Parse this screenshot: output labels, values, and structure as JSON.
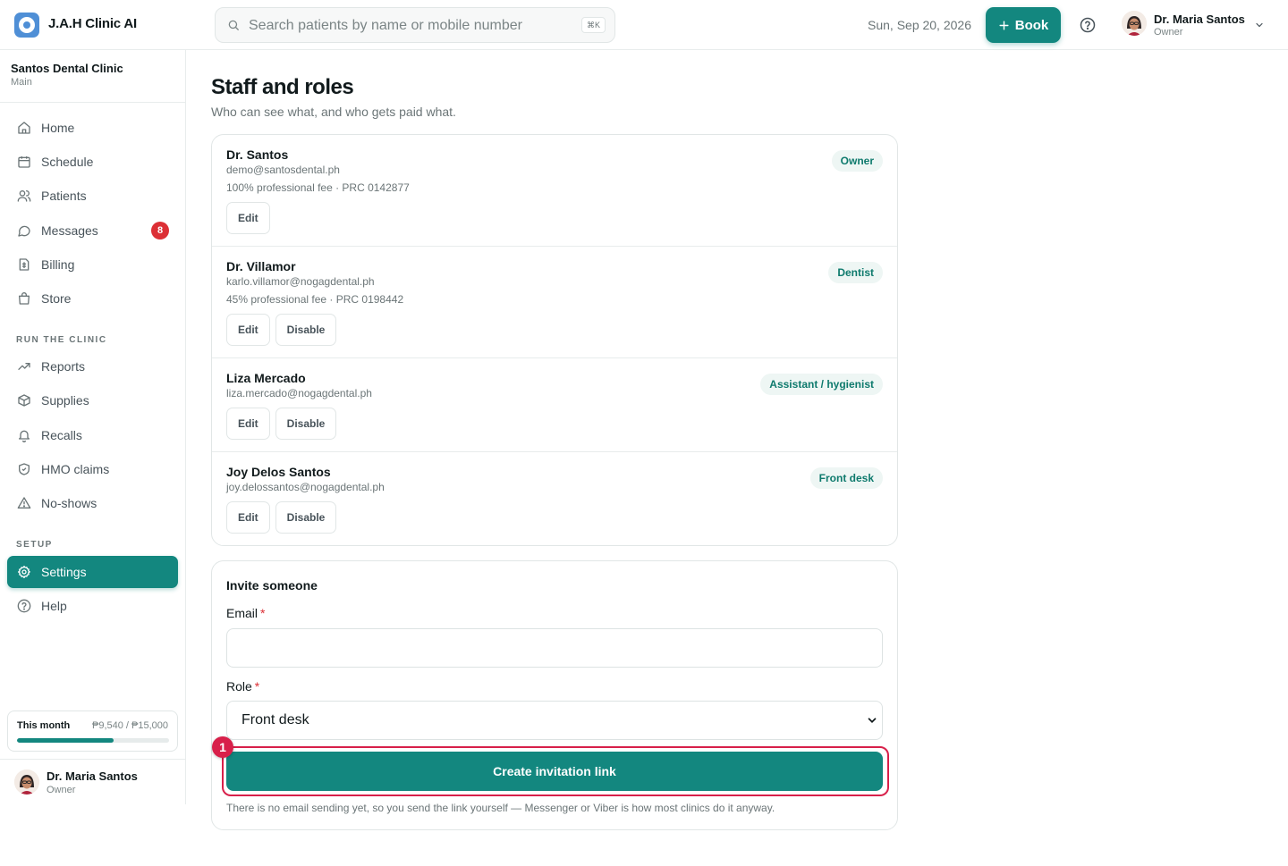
{
  "app": {
    "brand": "J.A.H Clinic AI",
    "search_placeholder": "Search patients by name or mobile number",
    "search_shortcut": "⌘K",
    "date": "Sun, Sep 20, 2026",
    "book_label": "Book",
    "user": {
      "name": "Dr. Maria Santos",
      "role": "Owner"
    },
    "accent_color": "#13877f"
  },
  "sidebar": {
    "clinic_name": "Santos Dental Clinic",
    "clinic_sub": "Main",
    "main_items": [
      {
        "label": "Home",
        "icon": "home-icon"
      },
      {
        "label": "Schedule",
        "icon": "calendar-icon"
      },
      {
        "label": "Patients",
        "icon": "users-icon"
      },
      {
        "label": "Messages",
        "icon": "chat-icon",
        "badge": "8"
      },
      {
        "label": "Billing",
        "icon": "receipt-icon"
      },
      {
        "label": "Store",
        "icon": "shopping-bag-icon"
      }
    ],
    "run_heading": "RUN THE CLINIC",
    "run_items": [
      {
        "label": "Reports",
        "icon": "trending-up-icon"
      },
      {
        "label": "Supplies",
        "icon": "box-icon"
      },
      {
        "label": "Recalls",
        "icon": "bell-icon"
      },
      {
        "label": "HMO claims",
        "icon": "shield-icon"
      },
      {
        "label": "No-shows",
        "icon": "warning-icon"
      }
    ],
    "setup_heading": "SETUP",
    "setup_items": [
      {
        "label": "Settings",
        "icon": "gear-icon",
        "active": true
      },
      {
        "label": "Help",
        "icon": "help-circle-icon"
      }
    ],
    "month": {
      "label": "This month",
      "value": "₱9,540 / ₱15,000",
      "progress": 0.636
    },
    "user": {
      "name": "Dr. Maria Santos",
      "role": "Owner"
    }
  },
  "page": {
    "title": "Staff and roles",
    "subtitle": "Who can see what, and who gets paid what."
  },
  "staff": [
    {
      "name": "Dr. Santos",
      "email": "demo@santosdental.ph",
      "fee": "100% professional fee · PRC 0142877",
      "role": "Owner",
      "actions": [
        "Edit"
      ]
    },
    {
      "name": "Dr. Villamor",
      "email": "karlo.villamor@nogagdental.ph",
      "fee": "45% professional fee · PRC 0198442",
      "role": "Dentist",
      "actions": [
        "Edit",
        "Disable"
      ]
    },
    {
      "name": "Liza Mercado",
      "email": "liza.mercado@nogagdental.ph",
      "fee": "",
      "role": "Assistant / hygienist",
      "actions": [
        "Edit",
        "Disable"
      ]
    },
    {
      "name": "Joy Delos Santos",
      "email": "joy.delossantos@nogagdental.ph",
      "fee": "",
      "role": "Front desk",
      "actions": [
        "Edit",
        "Disable"
      ]
    }
  ],
  "invite": {
    "title": "Invite someone",
    "email_label": "Email",
    "email_value": "",
    "role_label": "Role",
    "role_value": "Front desk",
    "required_mark": "*",
    "submit_label": "Create invitation link",
    "step_marker": "1",
    "hint": "There is no email sending yet, so you send the link yourself — Messenger or Viber is how most clinics do it anyway."
  }
}
